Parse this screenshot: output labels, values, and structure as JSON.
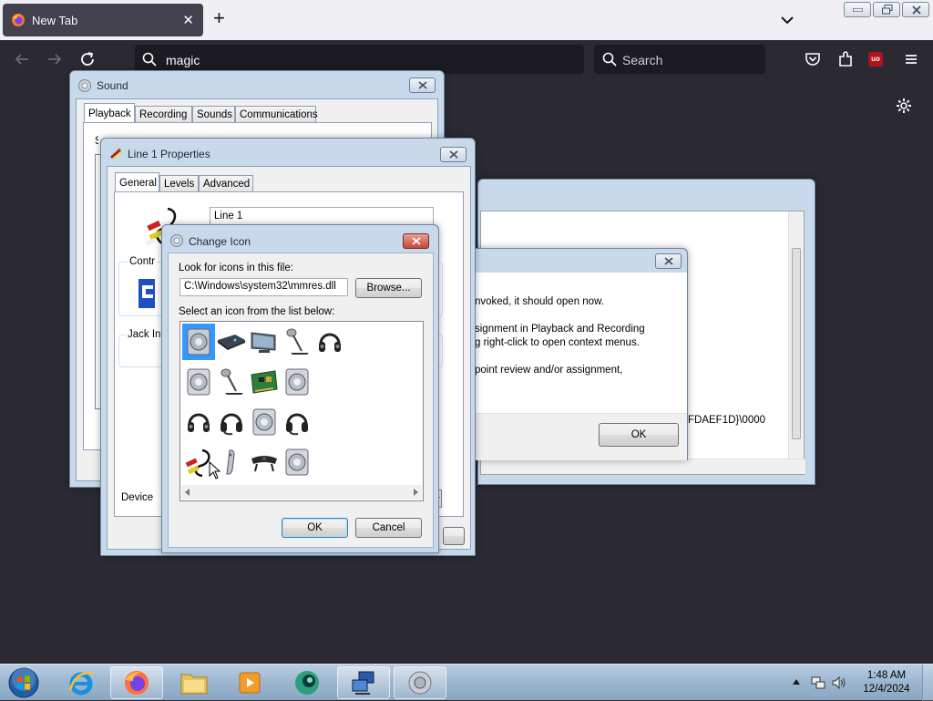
{
  "browser": {
    "tab_title": "New Tab",
    "url_value": "magic",
    "search_placeholder": "Search"
  },
  "sound_window": {
    "title": "Sound",
    "tabs": [
      "Playback",
      "Recording",
      "Sounds",
      "Communications"
    ],
    "partial_text": "Select a playback device below to modify its settings:",
    "device_label": "Device"
  },
  "line_props": {
    "title": "Line 1 Properties",
    "tabs": [
      "General",
      "Levels",
      "Advanced"
    ],
    "name_value": "Line 1",
    "controller_label": "Contr",
    "jack_label": "Jack In"
  },
  "back_dialog": {
    "lines": [
      "nvoked, it should open now.",
      "signment in Playback and Recording",
      "g right-click to open context menus.",
      "point review and/or assignment,"
    ],
    "guid_tail": "FDAEF1D}\\0000",
    "ok_label": "OK"
  },
  "change_icon": {
    "title": "Change Icon",
    "look_label": "Look for icons in this file:",
    "file_value": "C:\\Windows\\system32\\mmres.dll",
    "browse_label": "Browse...",
    "select_label": "Select an icon from the list below:",
    "ok_label": "OK",
    "cancel_label": "Cancel",
    "icons": [
      [
        "speaker-icon",
        "receiver-icon",
        "monitor-icon",
        "microphone-icon",
        "headphones-icon"
      ],
      [
        "speaker-icon",
        "microphone-icon",
        "sound-card-icon",
        "speaker-icon"
      ],
      [
        "headphones-icon",
        "headset-icon",
        "speaker-icon",
        "headset-icon"
      ],
      [
        "rca-cable-icon",
        "handset-icon",
        "webcam-icon",
        "speaker-icon"
      ]
    ],
    "selected_index": 0
  },
  "taskbar": {
    "time": "1:48 AM",
    "date": "12/4/2024",
    "items": [
      "start-orb-icon",
      "internet-explorer-icon",
      "firefox-icon",
      "explorer-folder-icon",
      "media-player-icon",
      "app-icon",
      "network-control-panel-icon",
      "sound-icon"
    ]
  }
}
